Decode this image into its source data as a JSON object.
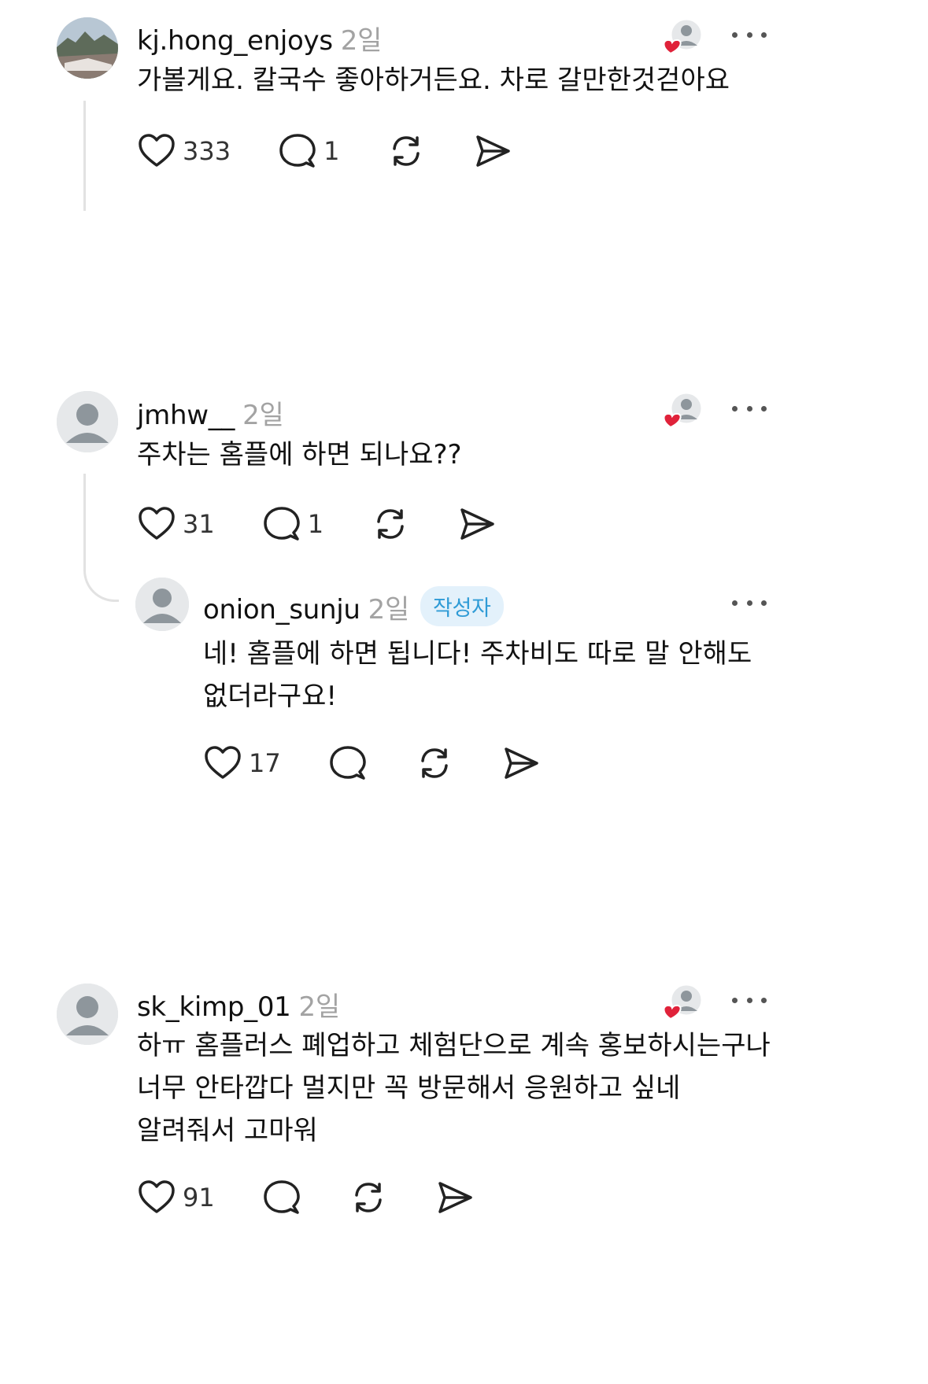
{
  "comments": [
    {
      "username": "kj.hong_enjoys",
      "time": "2일",
      "text": "가볼게요. 칼국수 좋아하거든요. 차로 갈만한것걷아요",
      "likes": "333",
      "replies": "1"
    },
    {
      "username": "jmhw__",
      "time": "2일",
      "text": "주차는 홈플에 하면 되나요??",
      "likes": "31",
      "replies": "1",
      "reply": {
        "username": "onion_sunju",
        "time": "2일",
        "badge": "작성자",
        "text": "네! 홈플에 하면 됩니다! 주차비도 따로 말 안해도\n없더라구요!",
        "likes": "17"
      }
    },
    {
      "username": "sk_kimp_01",
      "time": "2일",
      "text": "하ㅠ 홈플러스 폐업하고 체험단으로 계속 홍보하시는구나\n너무 안타깝다 멀지만 꼭 방문해서 응원하고 싶네\n알려줘서 고마워",
      "likes": "91"
    }
  ],
  "colors": {
    "heart_badge": "#e0223a",
    "author_badge_bg": "#e3f1fb",
    "author_badge_text": "#2f9bd6",
    "time_text": "#a3a3a3"
  },
  "icons": [
    "heart-icon",
    "comment-icon",
    "repost-icon",
    "share-icon",
    "more-icon",
    "liked-by-author-icon"
  ]
}
